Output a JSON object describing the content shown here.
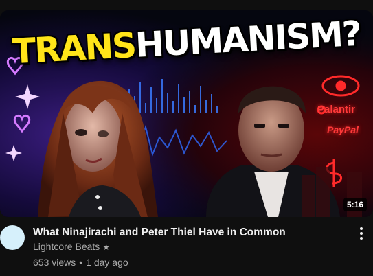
{
  "thumbnail": {
    "headline_part1": "TRANS",
    "headline_part2": "HUMANISM?",
    "brand_palantir": "Palantir",
    "brand_paypal": "PayPal",
    "duration": "5:16",
    "colors": {
      "headline_yellow": "#ffe419",
      "neon_purple": "#b44cff",
      "neon_red": "#ff2a2a",
      "neon_blue": "#3a7bff"
    }
  },
  "video": {
    "title": "What Ninajirachi and Peter Thiel Have in Common",
    "channel": "Lightcore Beats",
    "verified_icon": "★",
    "views": "653 views",
    "separator": "•",
    "age": "1 day ago",
    "avatar_color": "#d6f0fb"
  },
  "menu": {
    "icon": "more-vertical-icon"
  }
}
